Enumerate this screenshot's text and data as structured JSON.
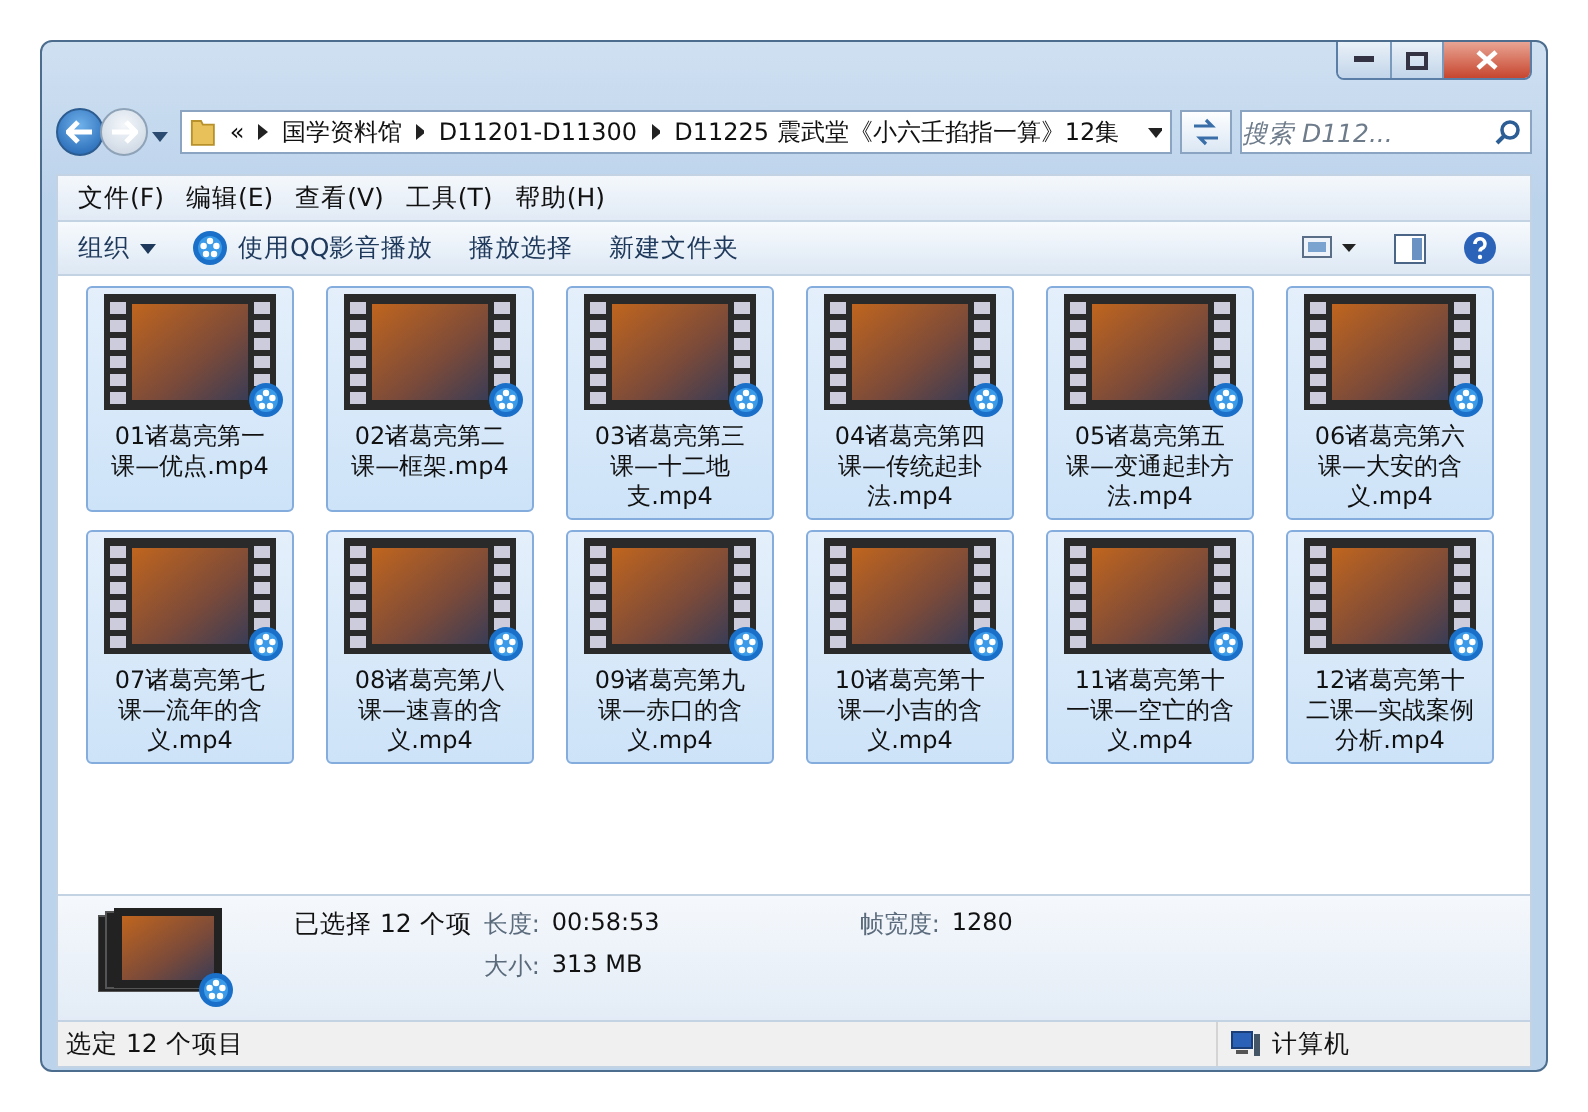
{
  "address": {
    "overflow": "«",
    "path": [
      "国学资料馆",
      "D11201-D11300",
      "D11225 震武堂《小六壬掐指一算》12集"
    ]
  },
  "search": {
    "placeholder": "搜索 D112..."
  },
  "menu": [
    "文件(F)",
    "编辑(E)",
    "查看(V)",
    "工具(T)",
    "帮助(H)"
  ],
  "toolbar": [
    {
      "label": "组织",
      "kind": "dropdown"
    },
    {
      "label": "使用QQ影音播放",
      "kind": "player"
    },
    {
      "label": "播放选择",
      "kind": "plain"
    },
    {
      "label": "新建文件夹",
      "kind": "plain"
    }
  ],
  "files": [
    {
      "name": "01诸葛亮第一课—优点.mp4",
      "selected": true
    },
    {
      "name": "02诸葛亮第二课—框架.mp4",
      "selected": true
    },
    {
      "name": "03诸葛亮第三课—十二地支.mp4",
      "selected": true
    },
    {
      "name": "04诸葛亮第四课—传统起卦法.mp4",
      "selected": true
    },
    {
      "name": "05诸葛亮第五课—变通起卦方法.mp4",
      "selected": true
    },
    {
      "name": "06诸葛亮第六课—大安的含义.mp4",
      "selected": true
    },
    {
      "name": "07诸葛亮第七课—流年的含义.mp4",
      "selected": true
    },
    {
      "name": "08诸葛亮第八课—速喜的含义.mp4",
      "selected": true
    },
    {
      "name": "09诸葛亮第九课—赤口的含义.mp4",
      "selected": true
    },
    {
      "name": "10诸葛亮第十课—小吉的含义.mp4",
      "selected": true
    },
    {
      "name": "11诸葛亮第十一课—空亡的含义.mp4",
      "selected": true
    },
    {
      "name": "12诸葛亮第十二课—实战案例分析.mp4",
      "selected": true
    }
  ],
  "details": {
    "summary": "已选择 12 个项",
    "fields": [
      {
        "label": "长度:",
        "value": "00:58:53"
      },
      {
        "label": "大小:",
        "value": "313 MB"
      },
      {
        "label": "帧宽度:",
        "value": "1280"
      }
    ]
  },
  "status_bar": {
    "text": "选定 12 个项目",
    "location": "计算机"
  }
}
